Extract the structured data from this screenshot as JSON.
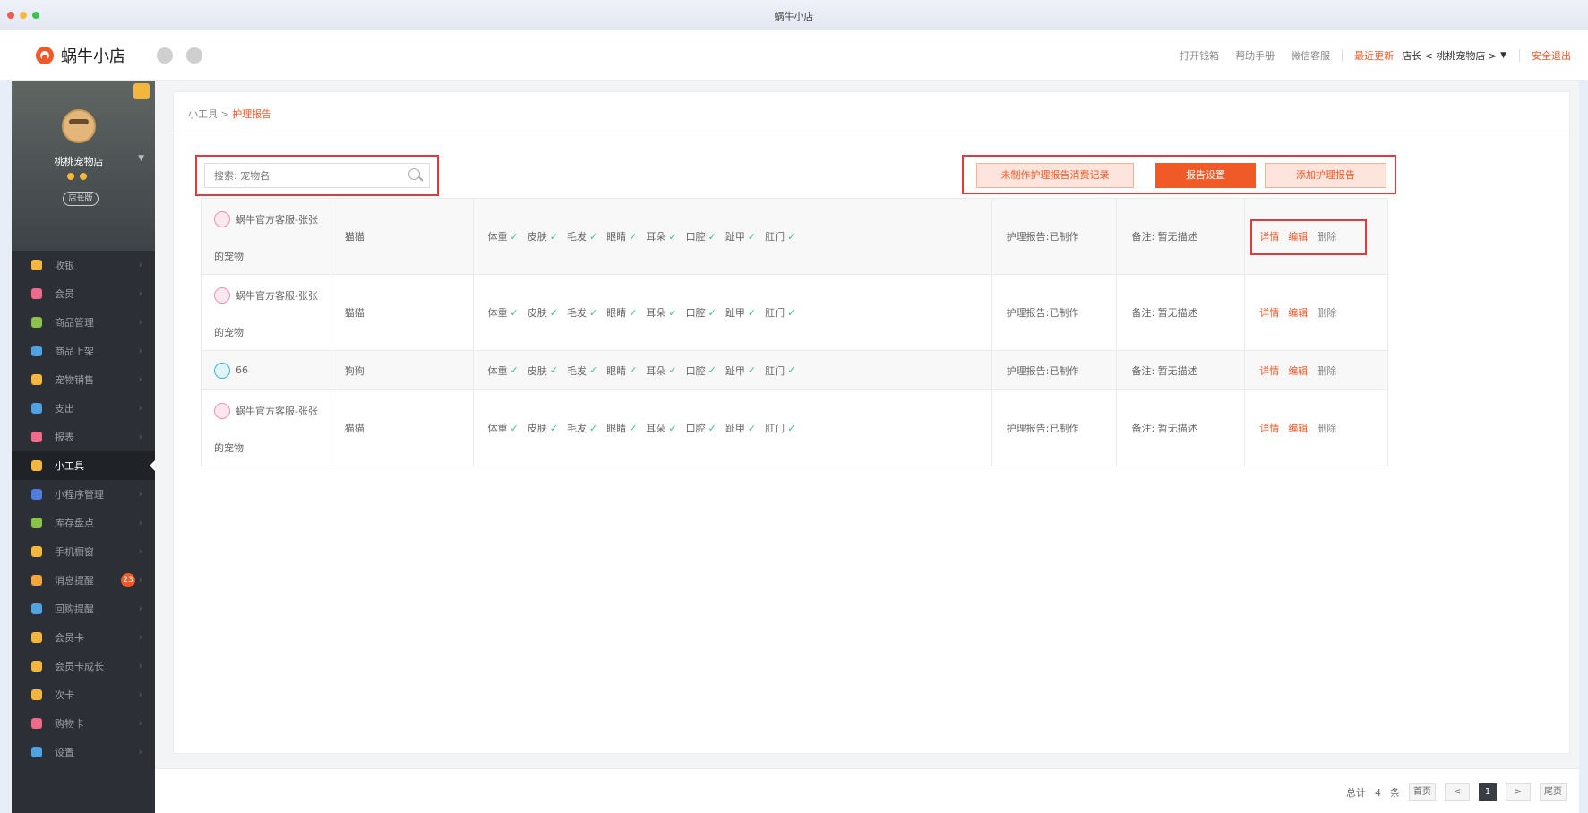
{
  "window": {
    "title": "蜗牛小店"
  },
  "header": {
    "logo_text": "蜗牛小店",
    "links": [
      "打开钱箱",
      "帮助手册",
      "微信客服"
    ],
    "recent_update": "最近更新",
    "role_shop": "店长 < 桃桃宠物店 >",
    "logout": "安全退出"
  },
  "sidebar": {
    "shop_name": "桃桃宠物店",
    "store_pill": "店长版",
    "items": [
      {
        "label": "收银",
        "color": "#f4b73b"
      },
      {
        "label": "会员",
        "color": "#f06a8a"
      },
      {
        "label": "商品管理",
        "color": "#8bc34a"
      },
      {
        "label": "商品上架",
        "color": "#4fa3e0"
      },
      {
        "label": "宠物销售",
        "color": "#f4b73b"
      },
      {
        "label": "支出",
        "color": "#4fa3e0"
      },
      {
        "label": "报表",
        "color": "#f06a8a"
      },
      {
        "label": "小工具",
        "color": "#f4b73b"
      },
      {
        "label": "小程序管理",
        "color": "#4f7de0"
      },
      {
        "label": "库存盘点",
        "color": "#8bc34a"
      },
      {
        "label": "手机橱窗",
        "color": "#f4b73b"
      },
      {
        "label": "消息提醒",
        "color": "#f4a63b",
        "badge": "23"
      },
      {
        "label": "回购提醒",
        "color": "#4fa3e0"
      },
      {
        "label": "会员卡",
        "color": "#f4b73b"
      },
      {
        "label": "会员卡成长",
        "color": "#f4b73b"
      },
      {
        "label": "次卡",
        "color": "#f4b73b"
      },
      {
        "label": "购物卡",
        "color": "#f06a8a"
      },
      {
        "label": "设置",
        "color": "#4fa3e0"
      }
    ],
    "active_index": 7
  },
  "breadcrumb": {
    "parent": "小工具",
    "separator": ">",
    "current": "护理报告"
  },
  "search": {
    "placeholder": "搜索: 宠物名",
    "value": ""
  },
  "actions": {
    "records": "未制作护理报告消费记录",
    "settings": "报告设置",
    "add": "添加护理报告"
  },
  "check_items": [
    "体重",
    "皮肤",
    "毛发",
    "眼睛",
    "耳朵",
    "口腔",
    "趾甲",
    "肛门"
  ],
  "rows": [
    {
      "pet_line1": "蜗牛官方客服-张张",
      "pet_line2": "的宠物",
      "avatar": "cat",
      "type": "猫猫",
      "status": "护理报告:已制作",
      "note": "备注: 暂无描述",
      "ops": [
        "详情",
        "编辑",
        "删除"
      ]
    },
    {
      "pet_line1": "蜗牛官方客服-张张",
      "pet_line2": "的宠物",
      "avatar": "cat",
      "type": "猫猫",
      "status": "护理报告:已制作",
      "note": "备注: 暂无描述",
      "ops": [
        "详情",
        "编辑",
        "删除"
      ]
    },
    {
      "pet_line1": "66",
      "pet_line2": "",
      "avatar": "dog",
      "type": "狗狗",
      "status": "护理报告:已制作",
      "note": "备注: 暂无描述",
      "ops": [
        "详情",
        "编辑",
        "删除"
      ]
    },
    {
      "pet_line1": "蜗牛官方客服-张张",
      "pet_line2": "的宠物",
      "avatar": "cat",
      "type": "猫猫",
      "status": "护理报告:已制作",
      "note": "备注: 暂无描述",
      "ops": [
        "详情",
        "编辑",
        "删除"
      ]
    }
  ],
  "pagination": {
    "total_label": "总计",
    "total": "4",
    "unit": "条",
    "first": "首页",
    "prev": "<",
    "current": "1",
    "next": ">",
    "last": "尾页"
  },
  "colors": {
    "accent": "#f05a28",
    "highlight": "#e13b3b",
    "check": "#3bbf8a",
    "sidebar": "#2c2f35"
  }
}
